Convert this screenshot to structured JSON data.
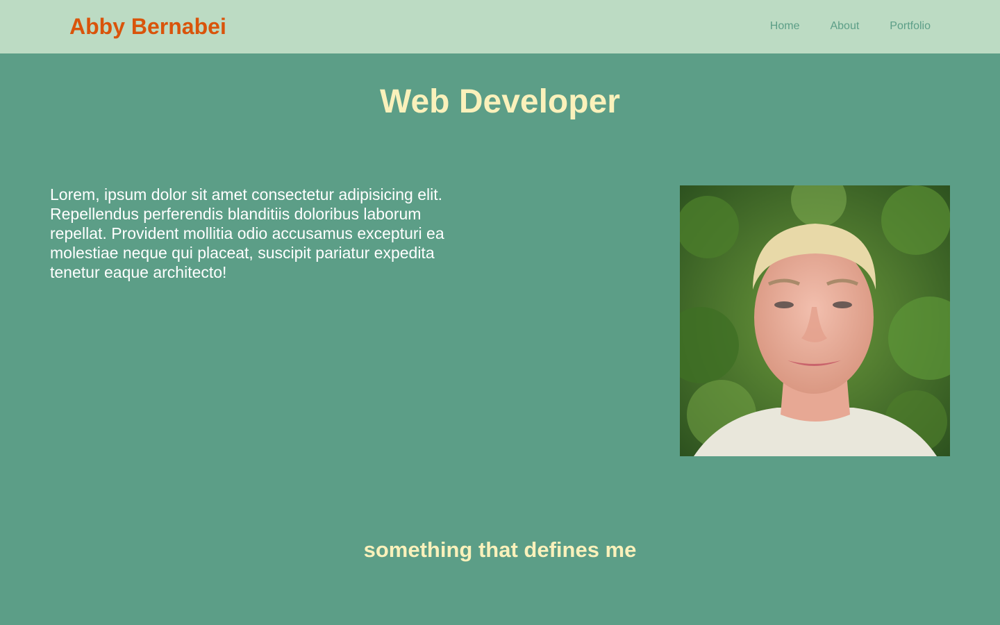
{
  "navbar": {
    "brand": "Abby Bernabei",
    "links": [
      "Home",
      "About",
      "Portfolio"
    ]
  },
  "hero": {
    "title": "Web Developer"
  },
  "intro": {
    "text": "Lorem, ipsum dolor sit amet consectetur adipisicing elit. Repellendus perferendis blanditiis doloribus laborum repellat. Provident mollitia odio accusamus excepturi ea molestiae neque qui placeat, suscipit pariatur expedita tenetur eaque architecto!"
  },
  "section": {
    "title": "something that defines me"
  },
  "colors": {
    "background": "#5c9e87",
    "navbar": "#bcdbc3",
    "brand": "#d9540b",
    "heading": "#faf1bb",
    "body_text": "#ffffff"
  }
}
